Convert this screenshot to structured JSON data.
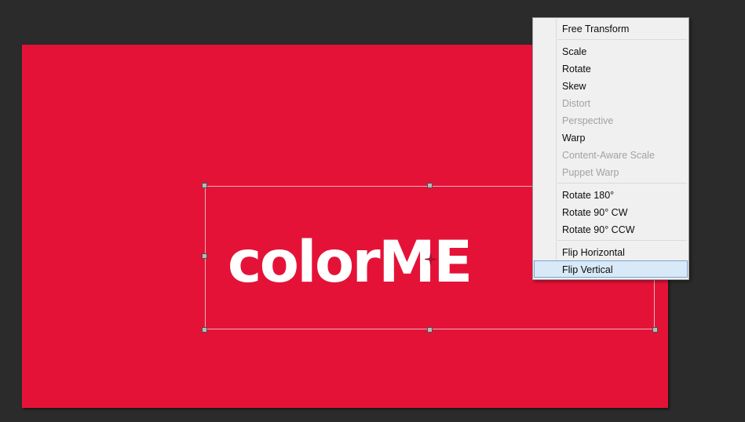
{
  "app": {
    "background_color": "#2b2b2b"
  },
  "canvas": {
    "name": "image-canvas",
    "fill_color": "#e51238",
    "artwork_text": "colorME",
    "artwork_color": "#ffffff"
  },
  "transform": {
    "name": "free-transform-bounding-box",
    "reference_point_icon": "transform-reference-point-icon",
    "handles": [
      "top-left",
      "top-center",
      "top-right",
      "middle-left",
      "middle-right",
      "bottom-left",
      "bottom-center",
      "bottom-right"
    ]
  },
  "context_menu": {
    "groups": [
      {
        "items": [
          {
            "label": "Free Transform",
            "disabled": false,
            "highlighted": false
          }
        ]
      },
      {
        "items": [
          {
            "label": "Scale",
            "disabled": false,
            "highlighted": false
          },
          {
            "label": "Rotate",
            "disabled": false,
            "highlighted": false
          },
          {
            "label": "Skew",
            "disabled": false,
            "highlighted": false
          },
          {
            "label": "Distort",
            "disabled": true,
            "highlighted": false
          },
          {
            "label": "Perspective",
            "disabled": true,
            "highlighted": false
          },
          {
            "label": "Warp",
            "disabled": false,
            "highlighted": false
          },
          {
            "label": "Content-Aware Scale",
            "disabled": true,
            "highlighted": false
          },
          {
            "label": "Puppet Warp",
            "disabled": true,
            "highlighted": false
          }
        ]
      },
      {
        "items": [
          {
            "label": "Rotate 180°",
            "disabled": false,
            "highlighted": false
          },
          {
            "label": "Rotate 90° CW",
            "disabled": false,
            "highlighted": false
          },
          {
            "label": "Rotate 90° CCW",
            "disabled": false,
            "highlighted": false
          }
        ]
      },
      {
        "items": [
          {
            "label": "Flip Horizontal",
            "disabled": false,
            "highlighted": false
          },
          {
            "label": "Flip Vertical",
            "disabled": false,
            "highlighted": true
          }
        ]
      }
    ],
    "colors": {
      "background": "#f0f0f0",
      "border": "#9a9a9a",
      "text": "#0c0c0c",
      "disabled_text": "#a2a2a2",
      "highlight_fill": "#d8e9f7",
      "highlight_border": "#7da2ce",
      "separator": "#dadada"
    }
  }
}
